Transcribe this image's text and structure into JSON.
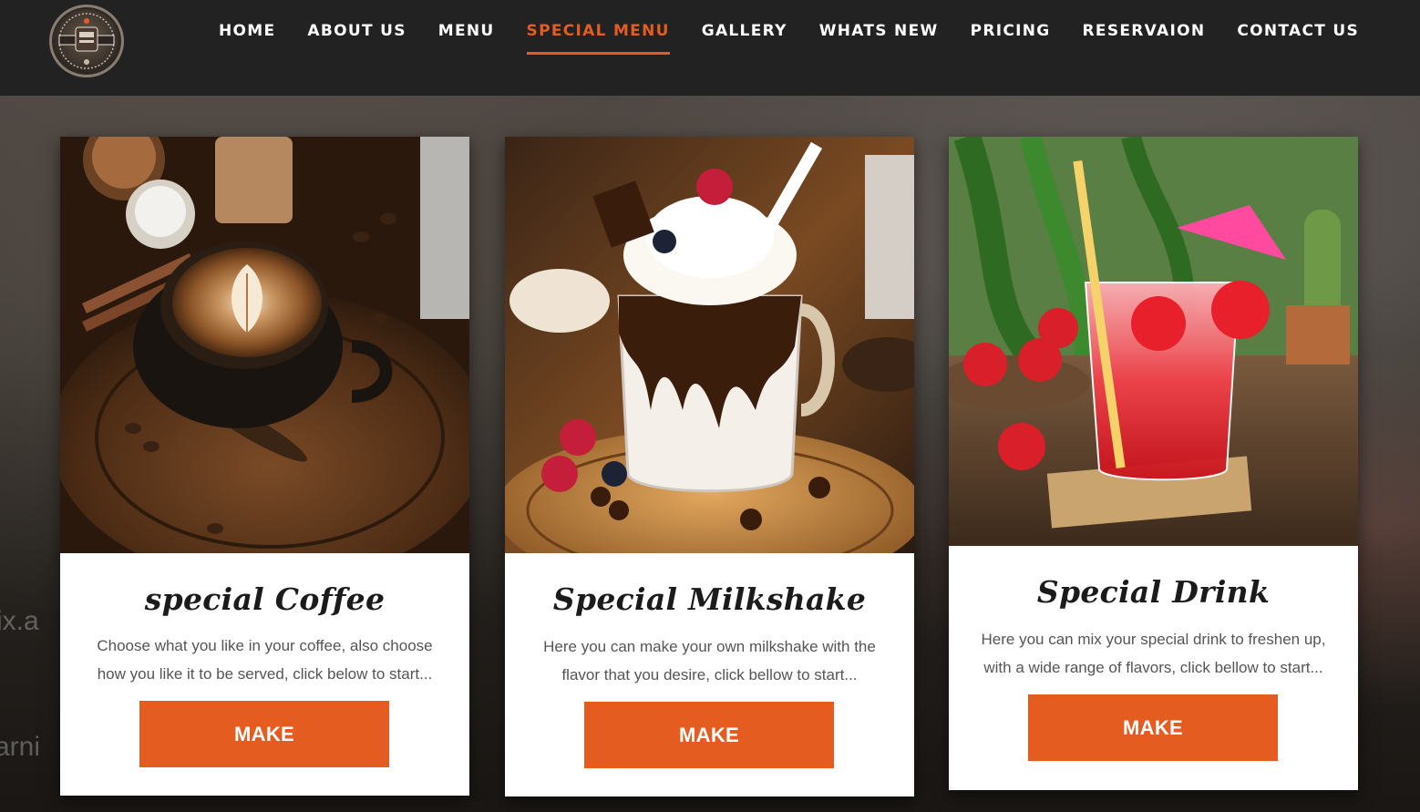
{
  "nav": {
    "items": [
      {
        "label": "HOME",
        "active": false
      },
      {
        "label": "ABOUT US",
        "active": false
      },
      {
        "label": "MENU",
        "active": false
      },
      {
        "label": "SPECIAL MENU",
        "active": true
      },
      {
        "label": "GALLERY",
        "active": false
      },
      {
        "label": "WHATS NEW",
        "active": false
      },
      {
        "label": "PRICING",
        "active": false
      },
      {
        "label": "RESERVAION",
        "active": false
      },
      {
        "label": "CONTACT US",
        "active": false
      }
    ]
  },
  "logo": {
    "icon": "coffee-shop-badge-icon"
  },
  "background": {
    "faint_text_1": "ix.a",
    "faint_text_2": "arni"
  },
  "cards": [
    {
      "title": "special Coffee",
      "description": "Choose what you like in your coffee, also choose how you like it to be served, click below to start...",
      "button_label": "MAKE",
      "image_icon": "latte-cup-image"
    },
    {
      "title": "Special Milkshake",
      "description": "Here you can make your own milkshake with the flavor that you desire, click bellow to start...",
      "button_label": "MAKE",
      "image_icon": "chocolate-milkshake-image"
    },
    {
      "title": "Special Drink",
      "description": "Here you can mix your special drink to freshen up, with a wide range of flavors, click bellow to start...",
      "button_label": "MAKE",
      "image_icon": "strawberry-drink-image"
    }
  ],
  "colors": {
    "accent": "#e45c1f",
    "header_bg": "#222222",
    "card_bg": "#ffffff"
  }
}
